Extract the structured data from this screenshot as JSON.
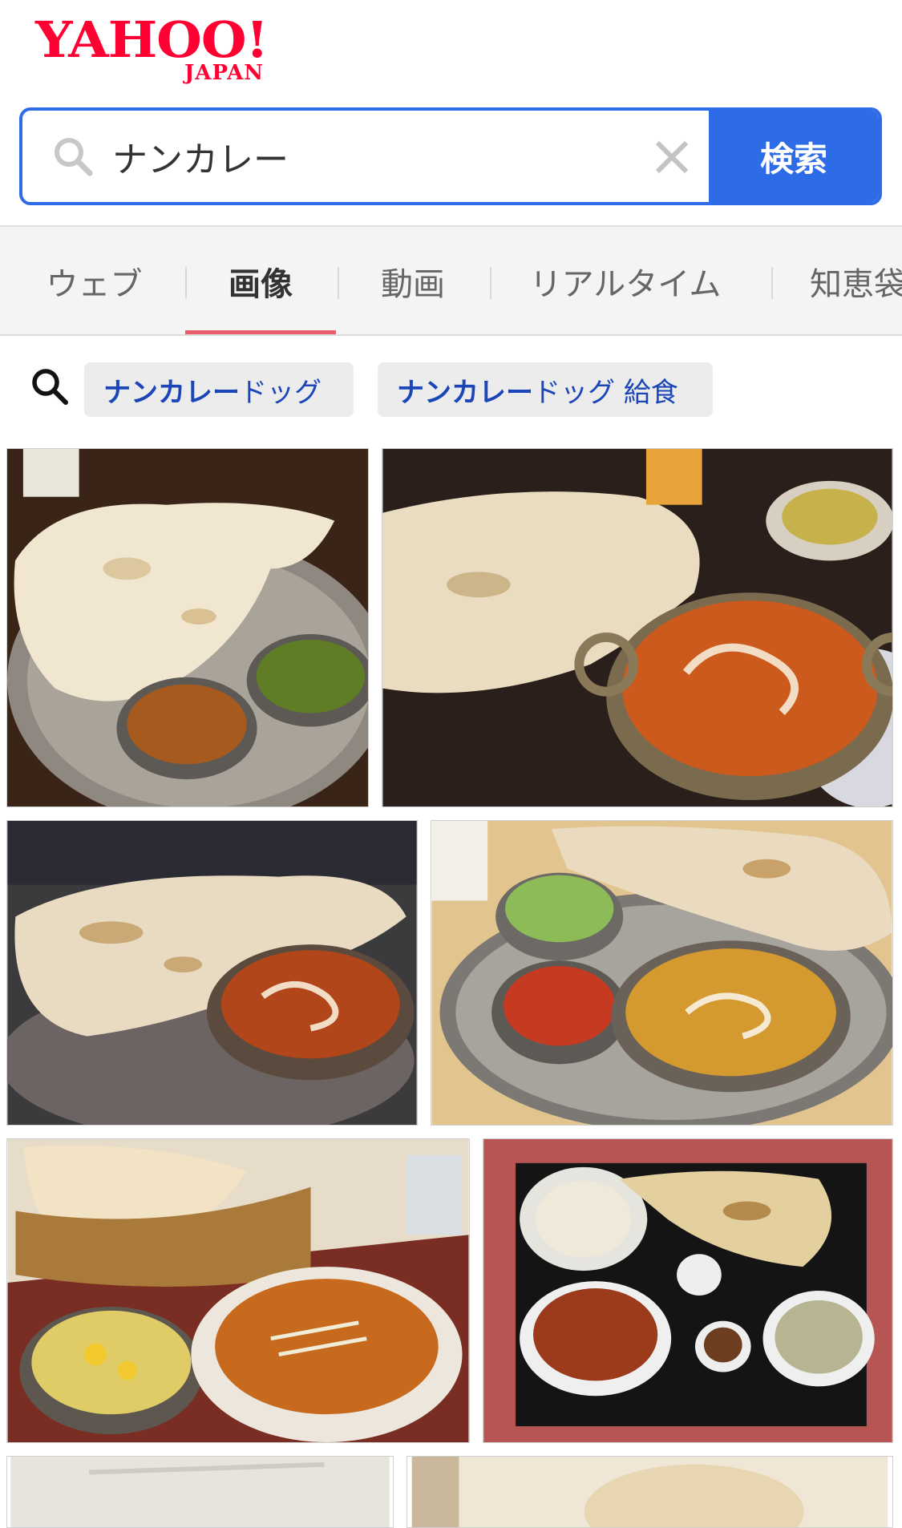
{
  "logo": {
    "main": "YAHOO!",
    "sub": "JAPAN"
  },
  "search": {
    "query": "ナンカレー",
    "button_label": "検索"
  },
  "tabs": [
    {
      "label": "ウェブ"
    },
    {
      "label": "画像"
    },
    {
      "label": "動画"
    },
    {
      "label": "リアルタイム"
    },
    {
      "label": "知恵袋"
    }
  ],
  "active_tab": "画像",
  "related": [
    {
      "bold": "ナンカレー",
      "rest": "ドッグ"
    },
    {
      "bold": "ナンカレー",
      "rest": "ドッグ 給食"
    }
  ],
  "colors": {
    "brand": "#ff0033",
    "accent": "#2e6be6",
    "tab_underline": "#ea5c6a",
    "chip_text": "#1a46b8"
  },
  "images": [
    {
      "subject": "naan with two curries on steel plate"
    },
    {
      "subject": "naan with butter chicken curry and salad"
    },
    {
      "subject": "large naan with curry in bowl"
    },
    {
      "subject": "thali with naan, salad, tandoori and curry"
    },
    {
      "subject": "naan basket, salad and keema curry"
    },
    {
      "subject": "curry set with rice, naan and salad on tray"
    },
    {
      "subject": "curry dish (partially visible)"
    },
    {
      "subject": "naan dish (partially visible)"
    }
  ]
}
